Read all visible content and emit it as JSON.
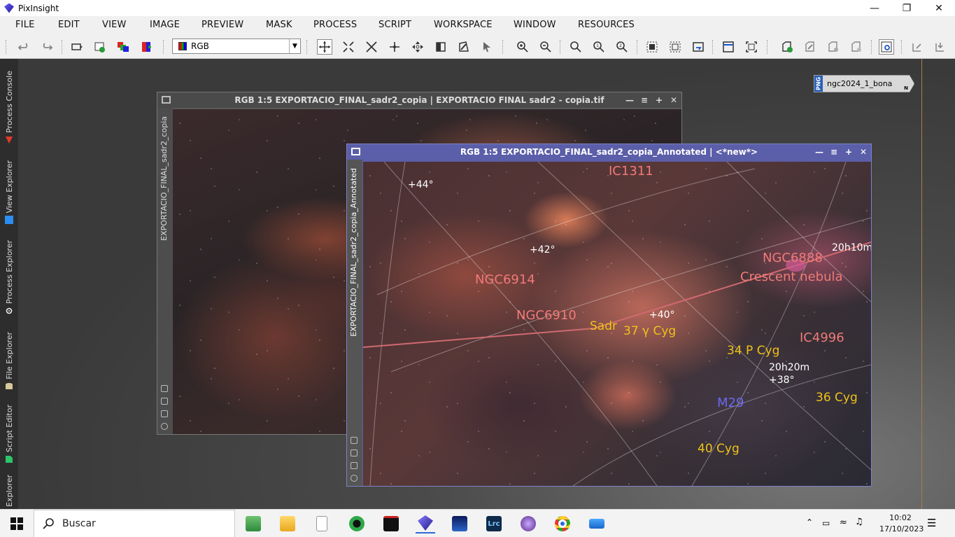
{
  "window": {
    "title": "PixInsight"
  },
  "menu": [
    "FILE",
    "EDIT",
    "VIEW",
    "IMAGE",
    "PREVIEW",
    "MASK",
    "PROCESS",
    "SCRIPT",
    "WORKSPACE",
    "WINDOW",
    "RESOURCES"
  ],
  "toolbar": {
    "channel_select": "RGB"
  },
  "sidebar": [
    "Process Console",
    "View Explorer",
    "Process Explorer",
    "File Explorer",
    "Script Editor",
    "Explorer"
  ],
  "thumbnail": {
    "format": "PNG",
    "name": "ngc2024_1_bona",
    "flag": "N"
  },
  "image_window_1": {
    "title": "RGB 1:5 EXPORTACIO_FINAL_sadr2_copia | EXPORTACIO FINAL sadr2 - copia.tif",
    "side_label": "EXPORTACIO_FINAL_sadr2_copia"
  },
  "image_window_2": {
    "title": "RGB 1:5 EXPORTACIO_FINAL_sadr2_copia_Annotated | <*new*>",
    "side_label": "EXPORTACIO_FINAL_sadr2_copia_Annotated",
    "annotations": {
      "ic1311": "IC1311",
      "dec44": "+44°",
      "dec42": "+42°",
      "dec40": "+40°",
      "dec38": "+38°",
      "ngc6914": "NGC6914",
      "ngc6910": "NGC6910",
      "ngc6888": "NGC6888",
      "crescent": "Crescent nebula",
      "ra2010": "20h10m",
      "ra2020": "20h20m",
      "sadr": "Sadr",
      "gamma_cyg": "37 γ Cyg",
      "p_cyg": "34 P Cyg",
      "ic4996": "IC4996",
      "m29": "M29",
      "cyg36": "36 Cyg",
      "cyg40": "40 Cyg"
    }
  },
  "taskbar": {
    "search_placeholder": "Buscar",
    "time": "10:02",
    "date": "17/10/2023"
  },
  "colors": {
    "annot_pink": "#f07a78",
    "annot_yellow": "#f0c21a",
    "annot_blue": "#6a6af0",
    "active_window": "#5b5ea8"
  }
}
